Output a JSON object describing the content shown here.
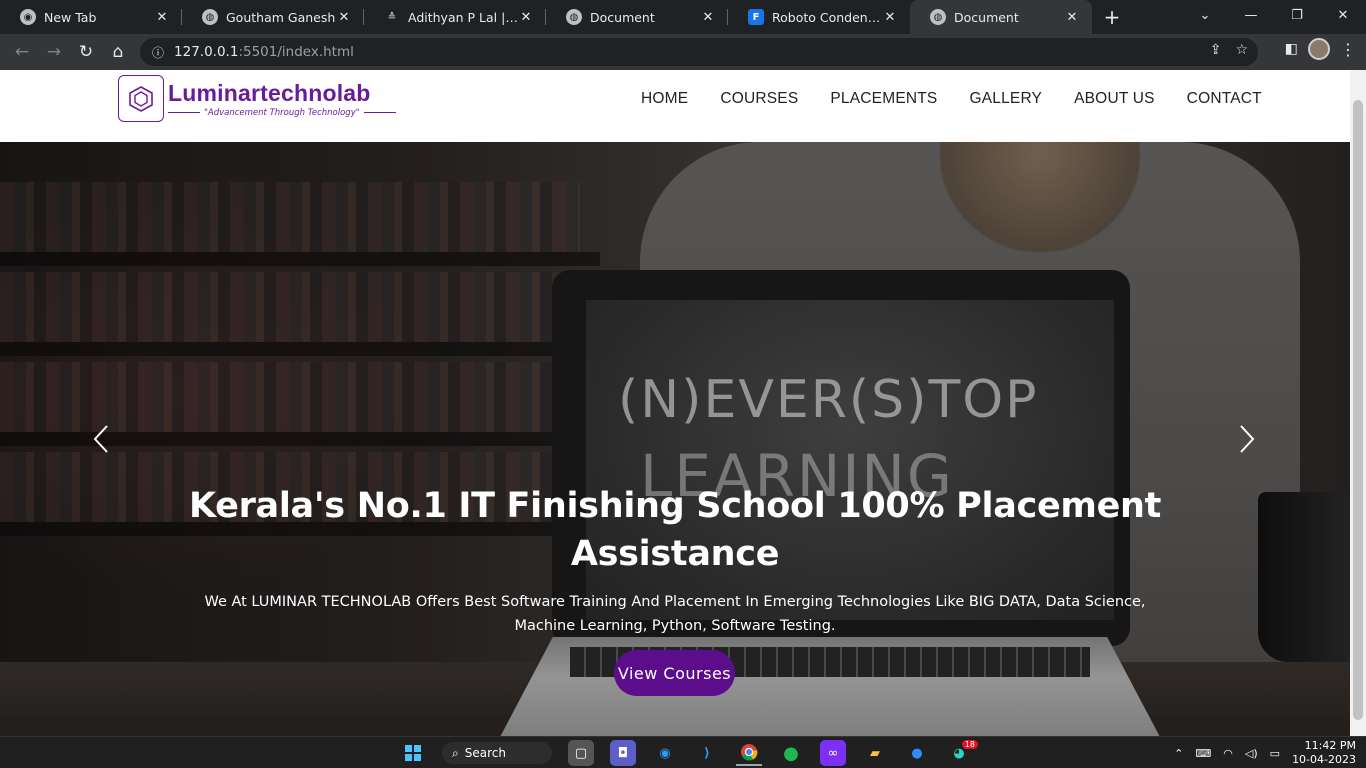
{
  "browser": {
    "tabs": [
      {
        "title": "New Tab",
        "icon": "chrome-icon",
        "active": false
      },
      {
        "title": "Goutham Ganesh",
        "icon": "globe-icon",
        "active": false
      },
      {
        "title": "Adithyan P Lal | Front-",
        "icon": "site-logo-icon",
        "active": false
      },
      {
        "title": "Document",
        "icon": "globe-icon",
        "active": false
      },
      {
        "title": "Roboto Condensed - ",
        "icon": "google-fonts-icon",
        "active": false
      },
      {
        "title": "Document",
        "icon": "globe-icon",
        "active": true
      }
    ],
    "url_host": "127.0.0.1",
    "url_path": ":5501/index.html"
  },
  "site": {
    "logo_name": "Luminartechnolab",
    "logo_tagline": "\"Advancement Through Technology\"",
    "nav": [
      "HOME",
      "COURSES",
      "PLACEMENTS",
      "GALLERY",
      "ABOUT US",
      "CONTACT"
    ],
    "hero": {
      "chalk_line1": "(N)EVER(S)TOP",
      "chalk_line2": "LEARNING",
      "title": "Kerala's No.1 IT Finishing School 100% Placement Assistance",
      "text": "We At LUMINAR TECHNOLAB Offers Best Software Training And Placement In Emerging Technologies Like BIG DATA, Data Science, Machine Learning, Python, Software Testing.",
      "cta": "View Courses",
      "cta_color": "#5b0d8c"
    },
    "brand_color": "#6a1b9a"
  },
  "taskbar": {
    "search_label": "Search",
    "chrome_badge": "18",
    "time": "11:42 PM",
    "date": "10-04-2023"
  }
}
